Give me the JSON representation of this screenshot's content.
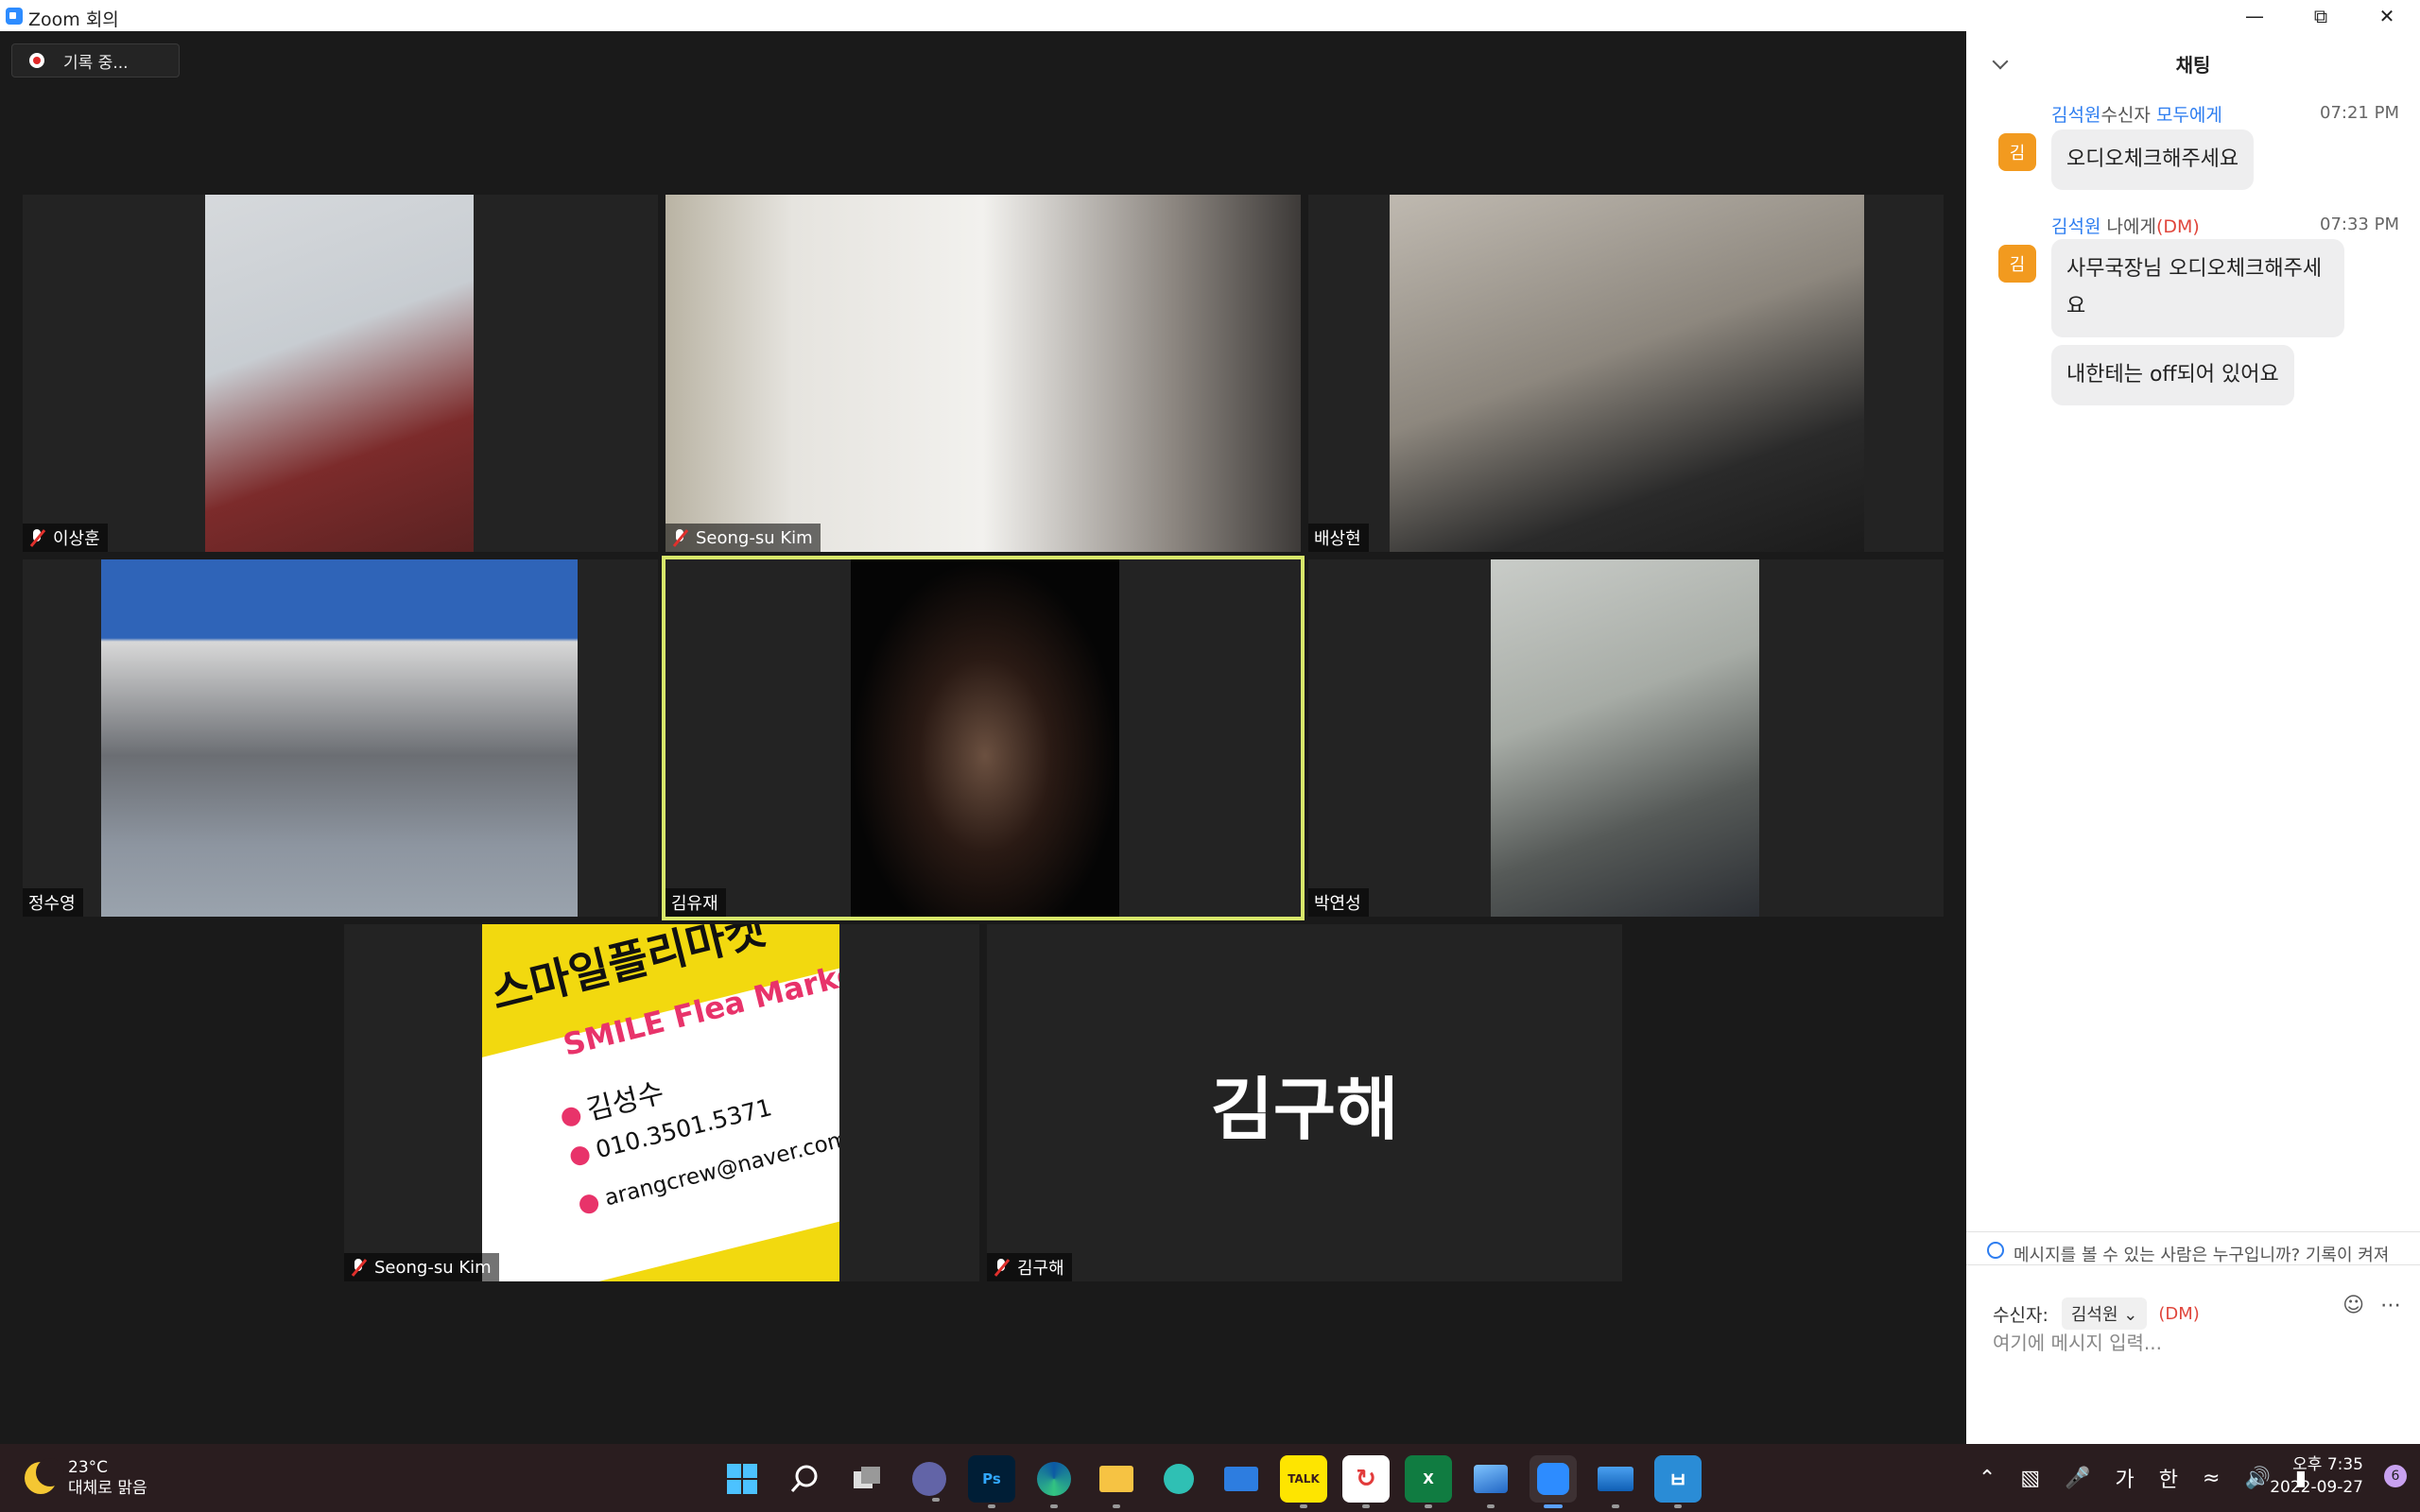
{
  "window": {
    "title": "Zoom 회의"
  },
  "recording": {
    "label": "기록 중..."
  },
  "participants": [
    {
      "name": "이상훈",
      "muted": true
    },
    {
      "name": "Seong-su Kim",
      "muted": true
    },
    {
      "name": "배상현",
      "muted": false
    },
    {
      "name": "정수영",
      "muted": false
    },
    {
      "name": "김유재",
      "muted": false,
      "active_speaker": true
    },
    {
      "name": "박연성",
      "muted": false
    },
    {
      "name": "Seong-su Kim",
      "muted": true
    },
    {
      "name": "김구해",
      "muted": true,
      "video_off_label": "김구해"
    }
  ],
  "shared_card": {
    "title": "스마일플리마켓",
    "subtitle": "SMILE Flea Market",
    "person": "김성수",
    "phone": "010.3501.5371",
    "email": "arangcrew@naver.com"
  },
  "chat": {
    "title": "채팅",
    "messages": [
      {
        "from": "김석원",
        "to_prefix": "수신자 ",
        "to": "모두에게",
        "dm": "",
        "time": "07:21 PM",
        "avatar": "김",
        "texts": [
          "오디오체크해주세요"
        ]
      },
      {
        "from": "김석원",
        "to_prefix": " 나에게",
        "to": "",
        "dm": "(DM)",
        "time": "07:33 PM",
        "avatar": "김",
        "texts": [
          "사무국장님 오디오체크해주세요",
          "내한테는 off되어 있어요"
        ]
      }
    ],
    "hint": "메시지를 볼 수 있는 사람은 누구입니까? 기록이 켜져",
    "recipient_label": "수신자:",
    "recipient_value": "김석원",
    "recipient_dm": "(DM)",
    "input_placeholder": "여기에 메시지 입력..."
  },
  "taskbar": {
    "temperature": "23°C",
    "weather": "대체로 맑음",
    "ime_lang": "가",
    "ime_mode": "한",
    "time": "오후 7:35",
    "date": "2022-09-27",
    "notifications": "6",
    "apps": [
      "start",
      "search",
      "task-view",
      "teams",
      "photoshop",
      "edge",
      "file-explorer",
      "app",
      "mail",
      "kakaotalk",
      "sync",
      "excel",
      "photos",
      "zoom",
      "app",
      "hancom"
    ]
  },
  "colors": {
    "accent": "#2d8cff",
    "active_border": "#d8e76a",
    "chat_name": "#2d7df0",
    "dm": "#e0463c",
    "avatar": "#f29a1f"
  }
}
